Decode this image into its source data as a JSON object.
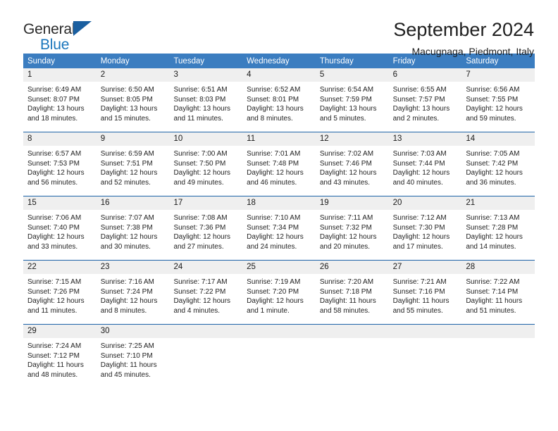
{
  "brand": {
    "name_part1": "General",
    "name_part2": "Blue",
    "accent_color": "#1a76bc",
    "triangle_color": "#1a5fa0",
    "triangle_icon": "triangle-icon"
  },
  "header": {
    "title": "September 2024",
    "location": "Macugnaga, Piedmont, Italy"
  },
  "calendar": {
    "header_bg": "#3b7dc0",
    "row_separator_color": "#1d63a8",
    "date_band_bg": "#efefef",
    "weekdays": [
      "Sunday",
      "Monday",
      "Tuesday",
      "Wednesday",
      "Thursday",
      "Friday",
      "Saturday"
    ],
    "weeks": [
      [
        {
          "day": "1",
          "sunrise": "Sunrise: 6:49 AM",
          "sunset": "Sunset: 8:07 PM",
          "daylight1": "Daylight: 13 hours",
          "daylight2": "and 18 minutes."
        },
        {
          "day": "2",
          "sunrise": "Sunrise: 6:50 AM",
          "sunset": "Sunset: 8:05 PM",
          "daylight1": "Daylight: 13 hours",
          "daylight2": "and 15 minutes."
        },
        {
          "day": "3",
          "sunrise": "Sunrise: 6:51 AM",
          "sunset": "Sunset: 8:03 PM",
          "daylight1": "Daylight: 13 hours",
          "daylight2": "and 11 minutes."
        },
        {
          "day": "4",
          "sunrise": "Sunrise: 6:52 AM",
          "sunset": "Sunset: 8:01 PM",
          "daylight1": "Daylight: 13 hours",
          "daylight2": "and 8 minutes."
        },
        {
          "day": "5",
          "sunrise": "Sunrise: 6:54 AM",
          "sunset": "Sunset: 7:59 PM",
          "daylight1": "Daylight: 13 hours",
          "daylight2": "and 5 minutes."
        },
        {
          "day": "6",
          "sunrise": "Sunrise: 6:55 AM",
          "sunset": "Sunset: 7:57 PM",
          "daylight1": "Daylight: 13 hours",
          "daylight2": "and 2 minutes."
        },
        {
          "day": "7",
          "sunrise": "Sunrise: 6:56 AM",
          "sunset": "Sunset: 7:55 PM",
          "daylight1": "Daylight: 12 hours",
          "daylight2": "and 59 minutes."
        }
      ],
      [
        {
          "day": "8",
          "sunrise": "Sunrise: 6:57 AM",
          "sunset": "Sunset: 7:53 PM",
          "daylight1": "Daylight: 12 hours",
          "daylight2": "and 56 minutes."
        },
        {
          "day": "9",
          "sunrise": "Sunrise: 6:59 AM",
          "sunset": "Sunset: 7:51 PM",
          "daylight1": "Daylight: 12 hours",
          "daylight2": "and 52 minutes."
        },
        {
          "day": "10",
          "sunrise": "Sunrise: 7:00 AM",
          "sunset": "Sunset: 7:50 PM",
          "daylight1": "Daylight: 12 hours",
          "daylight2": "and 49 minutes."
        },
        {
          "day": "11",
          "sunrise": "Sunrise: 7:01 AM",
          "sunset": "Sunset: 7:48 PM",
          "daylight1": "Daylight: 12 hours",
          "daylight2": "and 46 minutes."
        },
        {
          "day": "12",
          "sunrise": "Sunrise: 7:02 AM",
          "sunset": "Sunset: 7:46 PM",
          "daylight1": "Daylight: 12 hours",
          "daylight2": "and 43 minutes."
        },
        {
          "day": "13",
          "sunrise": "Sunrise: 7:03 AM",
          "sunset": "Sunset: 7:44 PM",
          "daylight1": "Daylight: 12 hours",
          "daylight2": "and 40 minutes."
        },
        {
          "day": "14",
          "sunrise": "Sunrise: 7:05 AM",
          "sunset": "Sunset: 7:42 PM",
          "daylight1": "Daylight: 12 hours",
          "daylight2": "and 36 minutes."
        }
      ],
      [
        {
          "day": "15",
          "sunrise": "Sunrise: 7:06 AM",
          "sunset": "Sunset: 7:40 PM",
          "daylight1": "Daylight: 12 hours",
          "daylight2": "and 33 minutes."
        },
        {
          "day": "16",
          "sunrise": "Sunrise: 7:07 AM",
          "sunset": "Sunset: 7:38 PM",
          "daylight1": "Daylight: 12 hours",
          "daylight2": "and 30 minutes."
        },
        {
          "day": "17",
          "sunrise": "Sunrise: 7:08 AM",
          "sunset": "Sunset: 7:36 PM",
          "daylight1": "Daylight: 12 hours",
          "daylight2": "and 27 minutes."
        },
        {
          "day": "18",
          "sunrise": "Sunrise: 7:10 AM",
          "sunset": "Sunset: 7:34 PM",
          "daylight1": "Daylight: 12 hours",
          "daylight2": "and 24 minutes."
        },
        {
          "day": "19",
          "sunrise": "Sunrise: 7:11 AM",
          "sunset": "Sunset: 7:32 PM",
          "daylight1": "Daylight: 12 hours",
          "daylight2": "and 20 minutes."
        },
        {
          "day": "20",
          "sunrise": "Sunrise: 7:12 AM",
          "sunset": "Sunset: 7:30 PM",
          "daylight1": "Daylight: 12 hours",
          "daylight2": "and 17 minutes."
        },
        {
          "day": "21",
          "sunrise": "Sunrise: 7:13 AM",
          "sunset": "Sunset: 7:28 PM",
          "daylight1": "Daylight: 12 hours",
          "daylight2": "and 14 minutes."
        }
      ],
      [
        {
          "day": "22",
          "sunrise": "Sunrise: 7:15 AM",
          "sunset": "Sunset: 7:26 PM",
          "daylight1": "Daylight: 12 hours",
          "daylight2": "and 11 minutes."
        },
        {
          "day": "23",
          "sunrise": "Sunrise: 7:16 AM",
          "sunset": "Sunset: 7:24 PM",
          "daylight1": "Daylight: 12 hours",
          "daylight2": "and 8 minutes."
        },
        {
          "day": "24",
          "sunrise": "Sunrise: 7:17 AM",
          "sunset": "Sunset: 7:22 PM",
          "daylight1": "Daylight: 12 hours",
          "daylight2": "and 4 minutes."
        },
        {
          "day": "25",
          "sunrise": "Sunrise: 7:19 AM",
          "sunset": "Sunset: 7:20 PM",
          "daylight1": "Daylight: 12 hours",
          "daylight2": "and 1 minute."
        },
        {
          "day": "26",
          "sunrise": "Sunrise: 7:20 AM",
          "sunset": "Sunset: 7:18 PM",
          "daylight1": "Daylight: 11 hours",
          "daylight2": "and 58 minutes."
        },
        {
          "day": "27",
          "sunrise": "Sunrise: 7:21 AM",
          "sunset": "Sunset: 7:16 PM",
          "daylight1": "Daylight: 11 hours",
          "daylight2": "and 55 minutes."
        },
        {
          "day": "28",
          "sunrise": "Sunrise: 7:22 AM",
          "sunset": "Sunset: 7:14 PM",
          "daylight1": "Daylight: 11 hours",
          "daylight2": "and 51 minutes."
        }
      ],
      [
        {
          "day": "29",
          "sunrise": "Sunrise: 7:24 AM",
          "sunset": "Sunset: 7:12 PM",
          "daylight1": "Daylight: 11 hours",
          "daylight2": "and 48 minutes."
        },
        {
          "day": "30",
          "sunrise": "Sunrise: 7:25 AM",
          "sunset": "Sunset: 7:10 PM",
          "daylight1": "Daylight: 11 hours",
          "daylight2": "and 45 minutes."
        },
        {
          "day": "",
          "sunrise": "",
          "sunset": "",
          "daylight1": "",
          "daylight2": ""
        },
        {
          "day": "",
          "sunrise": "",
          "sunset": "",
          "daylight1": "",
          "daylight2": ""
        },
        {
          "day": "",
          "sunrise": "",
          "sunset": "",
          "daylight1": "",
          "daylight2": ""
        },
        {
          "day": "",
          "sunrise": "",
          "sunset": "",
          "daylight1": "",
          "daylight2": ""
        },
        {
          "day": "",
          "sunrise": "",
          "sunset": "",
          "daylight1": "",
          "daylight2": ""
        }
      ]
    ]
  }
}
